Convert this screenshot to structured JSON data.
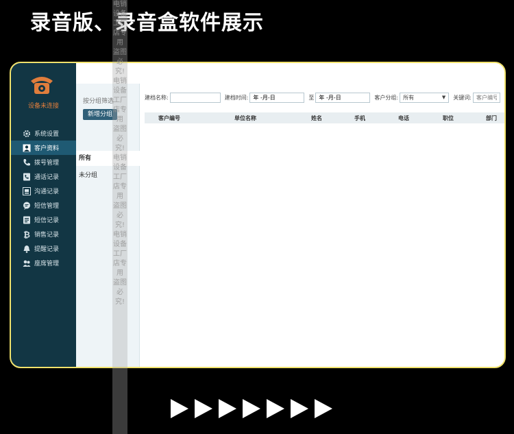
{
  "headline": "录音版、录音盒软件展示",
  "sidebar": {
    "device_status": "设备未连接",
    "items": [
      {
        "label": "系统设置",
        "icon": "gear-icon"
      },
      {
        "label": "客户资料",
        "icon": "contact-icon",
        "active": true
      },
      {
        "label": "拨号管理",
        "icon": "phone-icon"
      },
      {
        "label": "通话记录",
        "icon": "call-log-icon"
      },
      {
        "label": "沟通记录",
        "icon": "chat-log-icon"
      },
      {
        "label": "短信管理",
        "icon": "sms-icon"
      },
      {
        "label": "短信记录",
        "icon": "sms-log-icon"
      },
      {
        "label": "销售记录",
        "icon": "sales-icon"
      },
      {
        "label": "提醒记录",
        "icon": "bell-icon"
      },
      {
        "label": "座席管理",
        "icon": "seat-icon"
      }
    ]
  },
  "group_panel": {
    "title": "按分组筛选",
    "add_button": "新增分组",
    "groups": [
      "所有",
      "未分组"
    ]
  },
  "filters": {
    "created_name_label": "建档名称:",
    "created_time_label": "建档时间:",
    "date_from": "年 -月-日",
    "to_label": "至",
    "date_to": "年 -月-日",
    "customer_group_label": "客户分组:",
    "customer_group_value": "所有",
    "keyword_label": "关键词:",
    "keyword_placeholder": "客户编号"
  },
  "table": {
    "headers": [
      "客户编号",
      "单位名称",
      "姓名",
      "手机",
      "电话",
      "职位",
      "部门"
    ]
  },
  "watermark": "电销设备工厂店专用 盗图必究! 电销设备工厂店专用 盗图必究! 电销设备工厂店专用 盗图必究! 电销设备工厂店专用 盗图必究!",
  "colors": {
    "frame_border": "#f1e26b",
    "sidebar_bg": "#123644",
    "accent_orange": "#e07d3c"
  }
}
